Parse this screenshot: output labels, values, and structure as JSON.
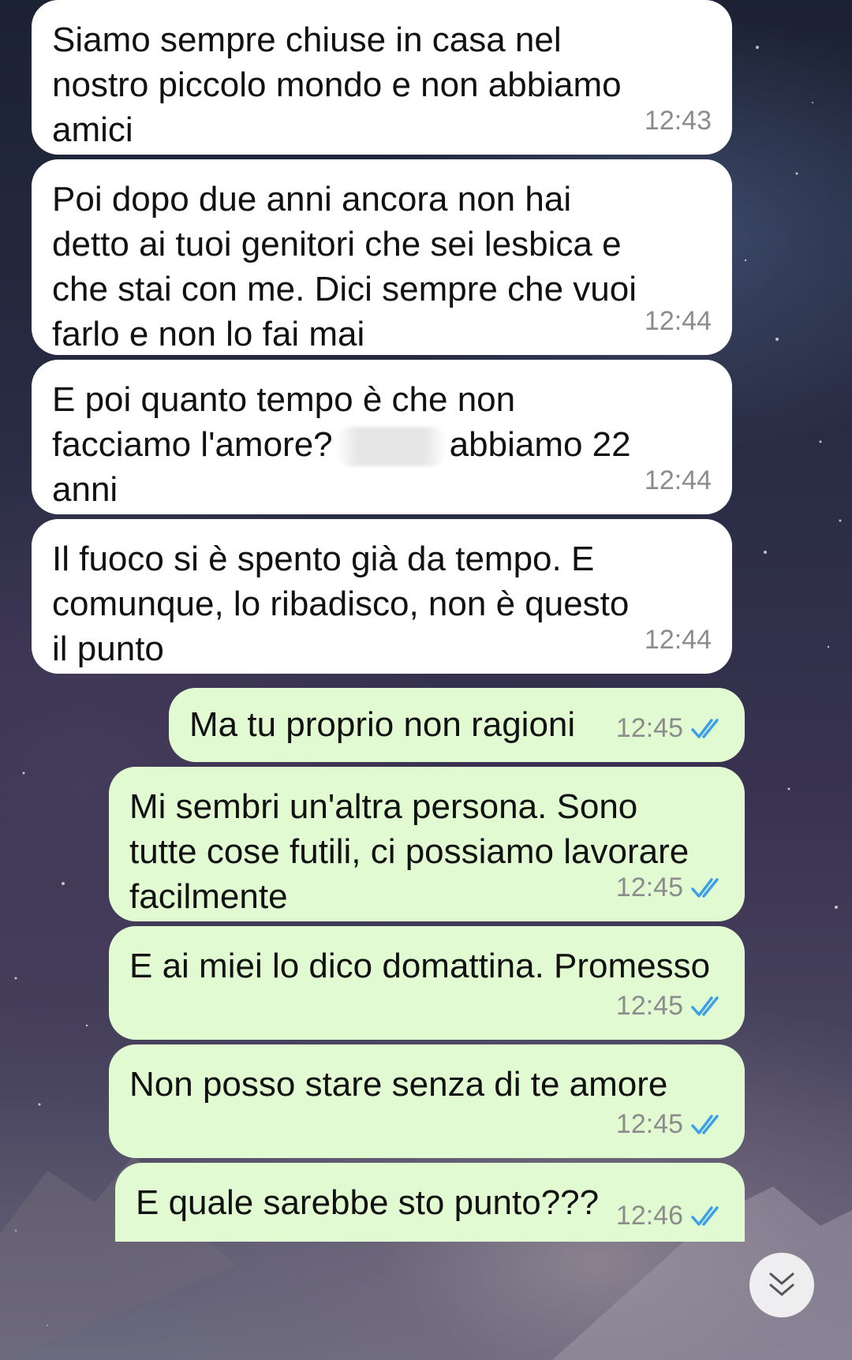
{
  "messages": [
    {
      "direction": "incoming",
      "text": "Siamo sempre chiuse in casa nel\nnostro piccolo mondo e non abbiamo\namici",
      "time": "12:43"
    },
    {
      "direction": "incoming",
      "text": "Poi dopo due anni ancora non hai\ndetto ai tuoi genitori che sei lesbica e\nche stai con me. Dici sempre che vuoi\nfarlo e non lo fai mai",
      "time": "12:44"
    },
    {
      "direction": "incoming",
      "text_before_redaction": "E poi quanto tempo è che non\nfacciamo l'amore?",
      "text_after_redaction": "abbiamo 22\nanni",
      "time": "12:44"
    },
    {
      "direction": "incoming",
      "text": "Il fuoco si è spento già da tempo. E\ncomunque, lo ribadisco, non è questo\nil punto",
      "time": "12:44"
    },
    {
      "direction": "outgoing",
      "text": "Ma tu proprio non ragioni",
      "time": "12:45",
      "status": "read"
    },
    {
      "direction": "outgoing",
      "text": "Mi sembri un'altra persona. Sono\ntutte cose futili, ci possiamo lavorare\nfacilmente",
      "time": "12:45",
      "status": "read"
    },
    {
      "direction": "outgoing",
      "text": "E ai miei lo dico domattina. Promesso",
      "time": "12:45",
      "status": "read"
    },
    {
      "direction": "outgoing",
      "text": "Non posso stare senza di te amore",
      "time": "12:45",
      "status": "read"
    },
    {
      "direction": "outgoing",
      "text": "E quale sarebbe sto punto???",
      "time": "12:46",
      "status": "read"
    }
  ],
  "icons": {
    "read_ticks": "double-check-icon",
    "scroll_down": "chevrons-down-icon"
  },
  "colors": {
    "incoming_bubble": "#ffffff",
    "outgoing_bubble": "#e2fad1",
    "read_tick": "#3aa0e8",
    "timestamp": "#8c8c8c"
  }
}
